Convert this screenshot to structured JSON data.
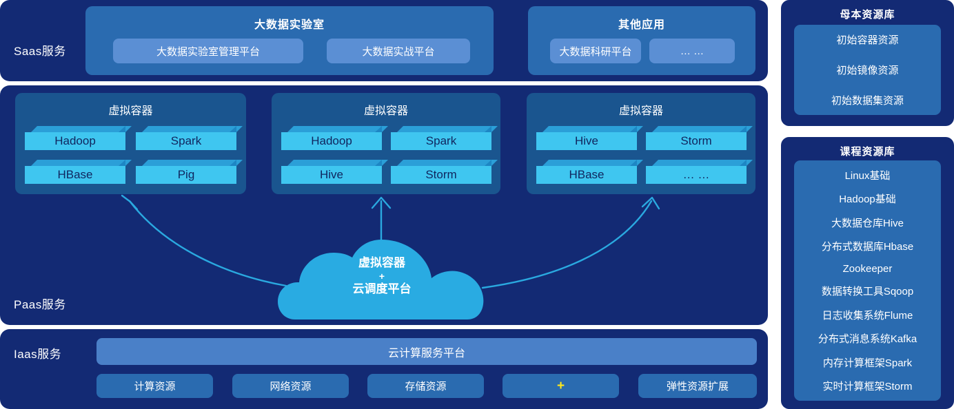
{
  "layers": {
    "saas": {
      "label": "Saas服务"
    },
    "paas": {
      "label": "Paas服务"
    },
    "iaas": {
      "label": "Iaas服务"
    }
  },
  "saas": {
    "groups": [
      {
        "title": "大数据实验室",
        "buttons": [
          "大数据实验室管理平台",
          "大数据实战平台"
        ]
      },
      {
        "title": "其他应用",
        "buttons": [
          "大数据科研平台",
          "… …"
        ]
      }
    ]
  },
  "paas": {
    "containers": [
      {
        "title": "虚拟容器",
        "items": [
          "Hadoop",
          "Spark",
          "HBase",
          "Pig"
        ]
      },
      {
        "title": "虚拟容器",
        "items": [
          "Hadoop",
          "Spark",
          "Hive",
          "Storm"
        ]
      },
      {
        "title": "虚拟容器",
        "items": [
          "Hive",
          "Storm",
          "HBase",
          "… …"
        ]
      }
    ],
    "cloud": {
      "line1": "虚拟容器",
      "line2": "+",
      "line3": "云调度平台"
    }
  },
  "iaas": {
    "platform_bar": "云计算服务平台",
    "resources": [
      "计算资源",
      "网络资源",
      "存储资源",
      "+",
      "弹性资源扩展"
    ]
  },
  "side_panels": [
    {
      "title": "母本资源库",
      "items": [
        "初始容器资源",
        "初始镜像资源",
        "初始数据集资源"
      ]
    },
    {
      "title": "课程资源库",
      "items": [
        "Linux基础",
        "Hadoop基础",
        "大数据仓库Hive",
        "分布式数据库Hbase",
        "Zookeeper",
        "数据转换工具Sqoop",
        "日志收集系统Flume",
        "分布式消息系统Kafka",
        "内存计算框架Spark",
        "实时计算框架Storm"
      ]
    }
  ],
  "colors": {
    "background": "#ffffff",
    "layer_navy": "#132a74",
    "group_blue": "#2a6bb0",
    "button_light_blue": "#5b8fd4",
    "container_blue": "#1a558f",
    "box_face_cyan": "#3fc6f0",
    "box_top_cyan": "#2b9fd8",
    "cloud_blue": "#29abe2",
    "platform_bar_blue": "#4a80c8",
    "plus_yellow": "#ffe81c",
    "arrow_blue": "#2aa9e0"
  }
}
